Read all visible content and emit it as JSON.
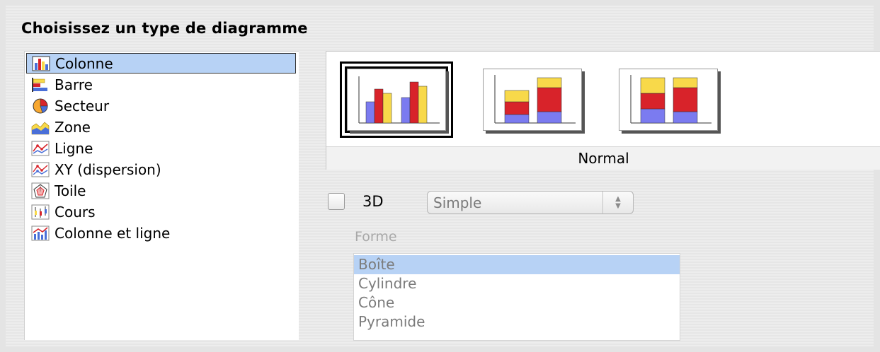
{
  "dialog": {
    "title": "Choisissez un type de diagramme"
  },
  "chart_types": [
    {
      "label": "Colonne",
      "icon": "column-chart-icon",
      "selected": true
    },
    {
      "label": "Barre",
      "icon": "bar-chart-icon",
      "selected": false
    },
    {
      "label": "Secteur",
      "icon": "pie-chart-icon",
      "selected": false
    },
    {
      "label": "Zone",
      "icon": "area-chart-icon",
      "selected": false
    },
    {
      "label": "Ligne",
      "icon": "line-chart-icon",
      "selected": false
    },
    {
      "label": "XY (dispersion)",
      "icon": "scatter-chart-icon",
      "selected": false
    },
    {
      "label": "Toile",
      "icon": "net-chart-icon",
      "selected": false
    },
    {
      "label": "Cours",
      "icon": "stock-chart-icon",
      "selected": false
    },
    {
      "label": "Colonne et ligne",
      "icon": "column-line-chart-icon",
      "selected": false
    }
  ],
  "variants": {
    "caption": "Normal",
    "items": [
      {
        "name": "normal",
        "selected": true
      },
      {
        "name": "stacked",
        "selected": false
      },
      {
        "name": "percent-stacked",
        "selected": false
      }
    ]
  },
  "three_d": {
    "label": "3D",
    "checked": false,
    "mode_value": "Simple"
  },
  "shape": {
    "label": "Forme",
    "options": [
      "Boîte",
      "Cylindre",
      "Cône",
      "Pyramide"
    ],
    "selected": "Boîte"
  },
  "colors": {
    "selection": "#b7d2f5",
    "series_blue": "#7b7bf0",
    "series_red": "#d8232a",
    "series_yellow": "#f8d94a"
  }
}
